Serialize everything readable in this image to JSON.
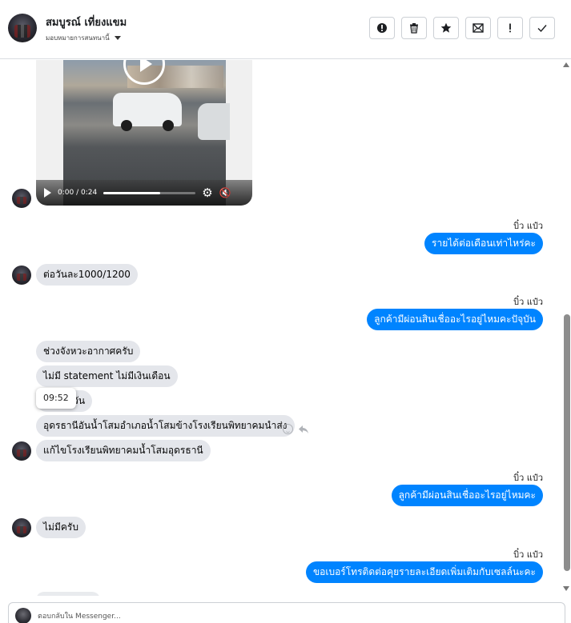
{
  "header": {
    "contact_name": "สมบูรณ์ เที่ยงแขม",
    "assign_label": "มอบหมายการสนทนานี้",
    "actions": [
      {
        "name": "mark-spam-button",
        "icon": "alert-circle-icon"
      },
      {
        "name": "delete-button",
        "icon": "trash-icon"
      },
      {
        "name": "star-button",
        "icon": "star-icon"
      },
      {
        "name": "mark-unread-button",
        "icon": "envelope-icon"
      },
      {
        "name": "follow-up-button",
        "icon": "exclamation-icon"
      },
      {
        "name": "mark-done-button",
        "icon": "check-icon"
      }
    ]
  },
  "video": {
    "time": "0:00 / 0:24",
    "progress": 0.62
  },
  "messages": {
    "m1_sender": "บิ๋ว แป๋ว",
    "m1_text": "รายได้ต่อเดือนเท่าไหร่คะ",
    "m2_text": "ต่อวันละ1000/1200",
    "m3_sender": "บิ๋ว แป๋ว",
    "m3_text": "ลูกค้ามีผ่อนสินเชื่ออะไรอยู่ไหมคะปัจุบัน",
    "m4_text": "ช่วงจังหวะอากาศครับ",
    "m5_text": "ไม่มี statement ไม่มีเงินเดือน",
    "m6_text": "ขายทุกวัน",
    "m7_text": "อุดรธานีอันน้ำโสมอำเภอน้ำโสมข้างโรงเรียนพิทยาคมนำส่ง",
    "m8_text": "แก้ไขโรงเรียนพิทยาคมน้ำโสมอุดรธานี",
    "m9_sender": "บิ๋ว แป๋ว",
    "m9_text": "ลูกค้ามีผ่อนสินเชื่ออะไรอยู่ไหมคะ",
    "m10_text": "ไม่มีครับ",
    "m11_sender": "บิ๋ว แป๋ว",
    "m11_text": "ขอเบอร์โทรติดต่อคุยรายละเอียดเพิ่มเติมกับเซลล์นะคะ"
  },
  "tooltip": {
    "time": "09:52"
  },
  "composer": {
    "placeholder": "ตอบกลับใน Messenger..."
  },
  "colors": {
    "outgoing_bubble": "#0084ff",
    "incoming_bubble": "#e4e6eb"
  }
}
